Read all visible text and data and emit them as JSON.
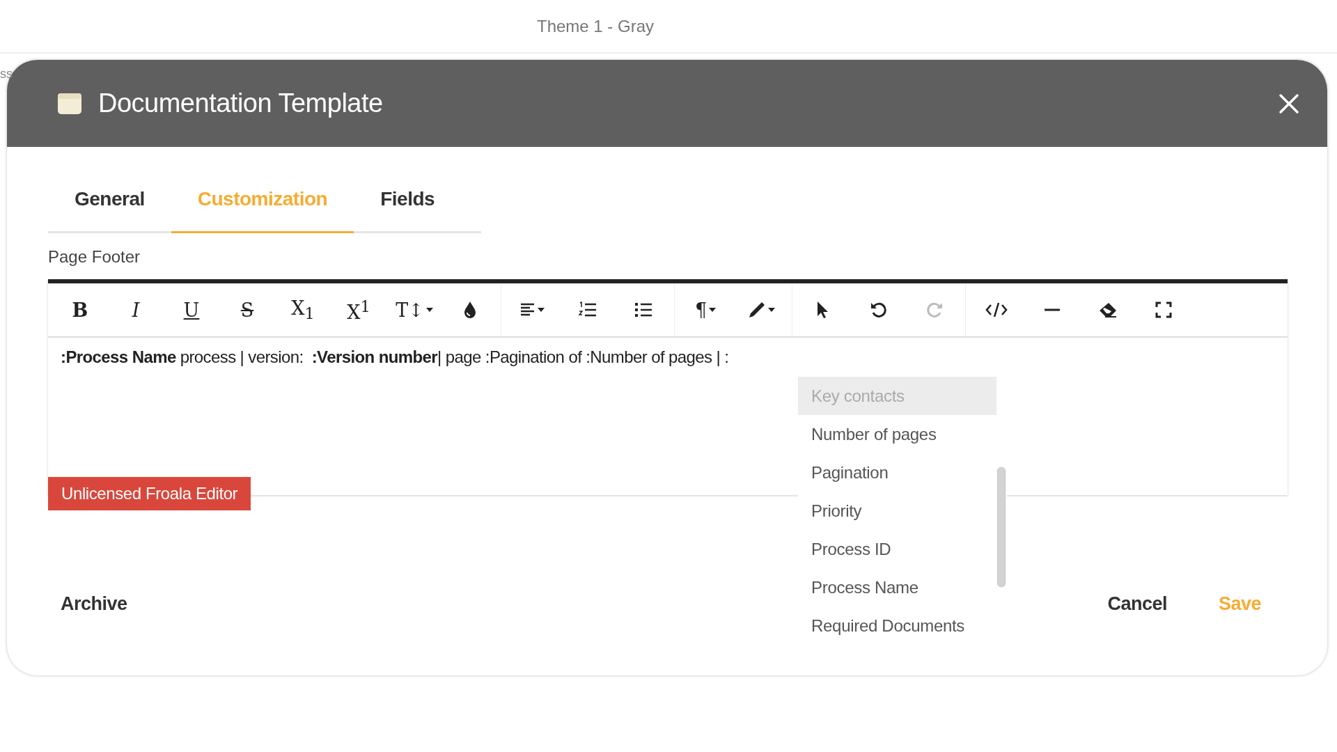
{
  "page": {
    "title": "Theme 1 - Gray",
    "behind_text": "ss"
  },
  "dialog": {
    "title": "Documentation Template"
  },
  "tabs": [
    {
      "label": "General",
      "selected": false
    },
    {
      "label": "Customization",
      "selected": true
    },
    {
      "label": "Fields",
      "selected": false
    }
  ],
  "field_label": "Page Footer",
  "toolbar": [
    [
      {
        "kind": "bold",
        "glyph": "B",
        "disabled": false,
        "dropdown": false
      },
      {
        "kind": "italic",
        "glyph": "I",
        "disabled": false,
        "dropdown": false
      },
      {
        "kind": "underline",
        "glyph": "U",
        "disabled": false,
        "dropdown": false
      },
      {
        "kind": "strike",
        "glyph": "S",
        "disabled": false,
        "dropdown": false
      },
      {
        "kind": "script",
        "glyph": "X$_{1}$",
        "disabled": false,
        "dropdown": false
      },
      {
        "kind": "script",
        "glyph": "X$^{1}$",
        "disabled": false,
        "dropdown": false
      },
      {
        "kind": "script",
        "glyph": "T↕",
        "disabled": false,
        "dropdown": true
      },
      {
        "kind": "color",
        "disabled": false,
        "dropdown": false
      }
    ],
    [
      {
        "kind": "align",
        "disabled": false,
        "dropdown": true
      },
      {
        "kind": "ordered-list",
        "disabled": false,
        "dropdown": false
      },
      {
        "kind": "bullet-list",
        "disabled": false,
        "dropdown": false
      }
    ],
    [
      {
        "kind": "script",
        "glyph": "¶",
        "disabled": false,
        "dropdown": true
      },
      {
        "kind": "pen",
        "disabled": false,
        "dropdown": true
      }
    ],
    [
      {
        "kind": "cursor",
        "disabled": false,
        "dropdown": false
      },
      {
        "kind": "undo",
        "disabled": false,
        "dropdown": false
      },
      {
        "kind": "redo",
        "disabled": true,
        "dropdown": false
      }
    ],
    [
      {
        "kind": "code",
        "disabled": false,
        "dropdown": false
      },
      {
        "kind": "rule",
        "disabled": false,
        "dropdown": false
      },
      {
        "kind": "eraser",
        "disabled": false,
        "dropdown": false
      },
      {
        "kind": "fullscreen",
        "disabled": false,
        "dropdown": false
      }
    ]
  ],
  "editor_text": "**:Process Name** process | version:  **:Version number**| page :Pagination of :Number of pages | :",
  "license_badge": "Unlicensed Froala Editor",
  "suggestions": [
    {
      "label": "Key contacts",
      "selected": true
    },
    {
      "label": "Number of pages",
      "selected": false
    },
    {
      "label": "Pagination",
      "selected": false
    },
    {
      "label": "Priority",
      "selected": false
    },
    {
      "label": "Process ID",
      "selected": false
    },
    {
      "label": "Process Name",
      "selected": false
    },
    {
      "label": "Required Documents",
      "selected": false
    }
  ],
  "buttons": [
    {
      "label": "Archive",
      "kind": "default"
    },
    {
      "label": "Cancel",
      "kind": "default"
    },
    {
      "label": "Save",
      "kind": "primary"
    }
  ]
}
